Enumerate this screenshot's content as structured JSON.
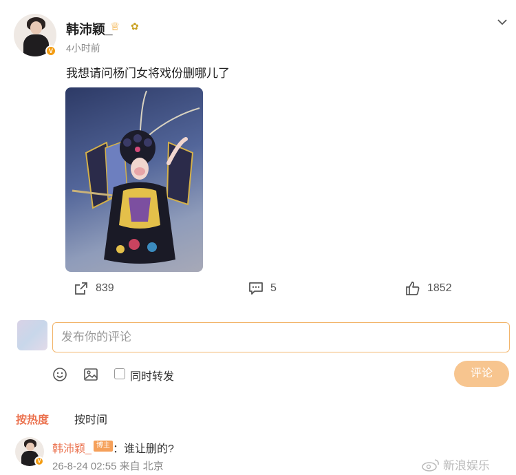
{
  "post": {
    "username": "韩沛颖_",
    "time": "4小时前",
    "verified_badge": "V",
    "text": "我想请问杨门女将戏份删哪儿了",
    "image_icon": "peking-opera-performer-photo",
    "reposts": "839",
    "comments": "5",
    "likes": "1852"
  },
  "composer": {
    "placeholder": "发布你的评论",
    "repost_label": "同时转发",
    "submit_label": "评论"
  },
  "sort": {
    "hot_label": "按热度",
    "time_label": "按时间"
  },
  "comment": {
    "username": "韩沛颖_",
    "badge": "博主",
    "text": "：谁让删的?",
    "meta": "26-8-24 02:55 来自 北京"
  },
  "watermark": {
    "text": "新浪娱乐"
  },
  "colors": {
    "accent": "#eb7350",
    "submit_bg": "#f7c58f",
    "input_border": "#f2b56b"
  }
}
